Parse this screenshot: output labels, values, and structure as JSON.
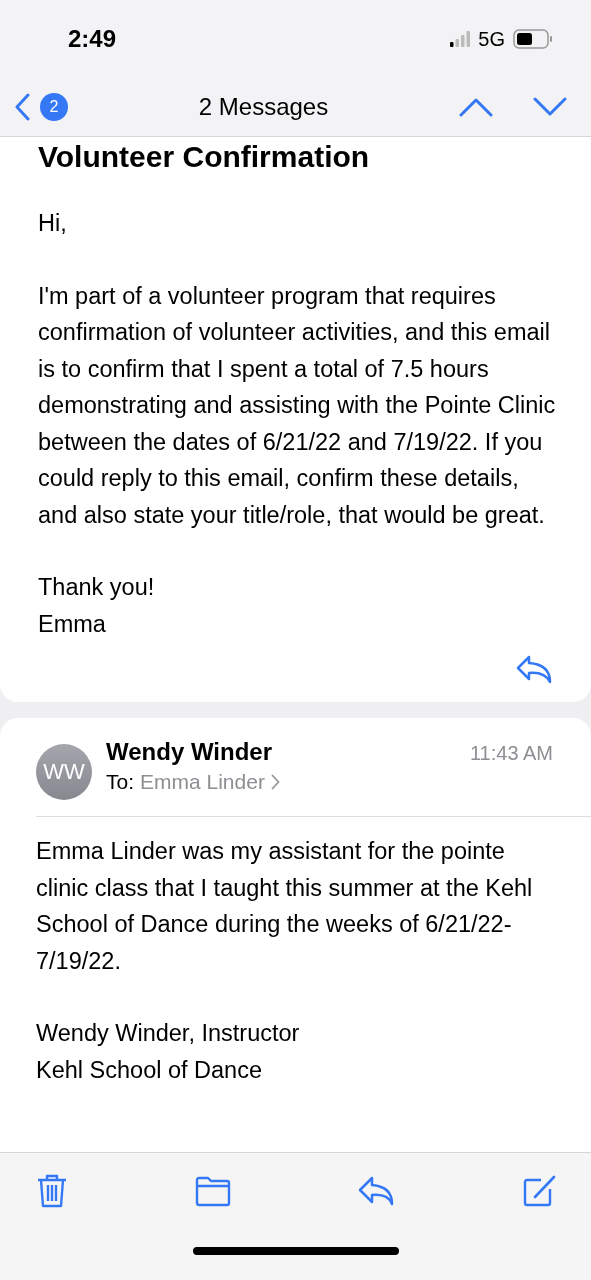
{
  "status_bar": {
    "time": "2:49",
    "network": "5G"
  },
  "nav_bar": {
    "badge": "2",
    "title": "2 Messages"
  },
  "messages": [
    {
      "subject": "Volunteer Confirmation",
      "paragraphs": [
        "Hi,",
        "I'm part of a volunteer program that requires confirmation of volunteer activities, and this email is to confirm that I spent a total of 7.5 hours demonstrating and assisting with the Pointe Clinic between the dates of 6/21/22 and 7/19/22. If you could reply to this email, confirm these details, and also state your title/role, that would be great.",
        "Thank you!\nEmma"
      ]
    },
    {
      "avatar": "WW",
      "sender": "Wendy Winder",
      "time": "11:43 AM",
      "to_label": "To:",
      "recipient": "Emma Linder",
      "paragraphs": [
        "Emma Linder was my assistant for the pointe clinic class that I taught this summer at the Kehl School of Dance during the weeks of 6/21/22-7/19/22.",
        "Wendy Winder, Instructor\nKehl School of Dance"
      ]
    }
  ]
}
